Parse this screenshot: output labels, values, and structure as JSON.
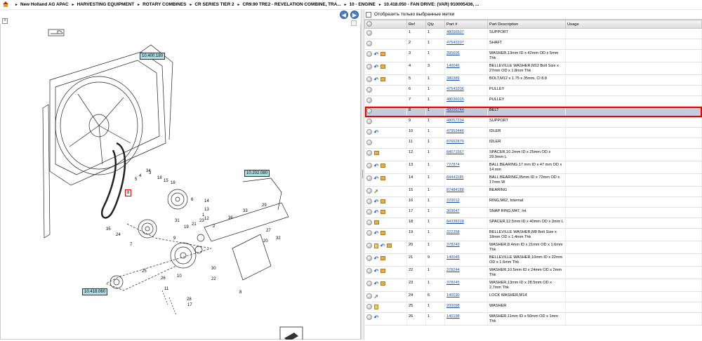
{
  "breadcrumb": [
    "New Holland AG APAC",
    "HARVESTING EQUIPMENT",
    "ROTARY COMBINES",
    "CR SERIES TIER 2",
    "CR9.90 TRE2 - REVELATION COMBINE, TRA...",
    "10 - ENGINE",
    "10.418.050 - FAN DRIVE: (VAR) 910005436, ..."
  ],
  "filter_label": "Отобразить только выбранные метки",
  "columns": [
    "",
    "Ref",
    "Qty",
    "Part #",
    "Part Description",
    "Usage"
  ],
  "colors": {
    "link": "#1a4fa8",
    "selected_row": "#c6ccd8",
    "highlight": "#ff0000",
    "callout": "#aedfe3"
  },
  "rows": [
    {
      "icons": [
        "circle"
      ],
      "ref": "1",
      "qty": "1",
      "part": "48056507",
      "desc": "SUPPORT",
      "usage": ""
    },
    {
      "icons": [
        "circle"
      ],
      "ref": "2",
      "qty": "1",
      "part": "47543207",
      "desc": "SHAFT",
      "usage": ""
    },
    {
      "icons": [
        "circle",
        "history",
        "box"
      ],
      "ref": "3",
      "qty": "1",
      "part": "395606",
      "desc": "WASHER,13mm ID x 42mm OD x 5mm Thk",
      "usage": ""
    },
    {
      "icons": [
        "circle",
        "history",
        "box"
      ],
      "ref": "4",
      "qty": "3",
      "part": "140046",
      "desc": "BELLEVILLE WASHER,M12 Bolt Size x 27mm OD x 1.8mm Thk",
      "usage": ""
    },
    {
      "icons": [
        "circle",
        "history",
        "box"
      ],
      "ref": "5",
      "qty": "1",
      "part": "380389",
      "desc": "BOLT,M12 x 1.75 x 35mm, Cl 8.8",
      "usage": ""
    },
    {
      "icons": [
        "circle"
      ],
      "ref": "6",
      "qty": "1",
      "part": "47543206",
      "desc": "PULLEY",
      "usage": ""
    },
    {
      "icons": [
        "circle"
      ],
      "ref": "7",
      "qty": "1",
      "part": "48036015",
      "desc": "PULLEY",
      "usage": ""
    },
    {
      "icons": [
        "circle"
      ],
      "ref": "8",
      "qty": "1",
      "part": "48056744",
      "desc": "BELT",
      "usage": "",
      "selected": true
    },
    {
      "icons": [
        "circle"
      ],
      "ref": "9",
      "qty": "1",
      "part": "48057234",
      "desc": "SUPPORT",
      "usage": ""
    },
    {
      "icons": [
        "circle",
        "history"
      ],
      "ref": "10",
      "qty": "1",
      "part": "47953446",
      "desc": "IDLER",
      "usage": ""
    },
    {
      "icons": [
        "circle"
      ],
      "ref": "11",
      "qty": "1",
      "part": "87662870",
      "desc": "IDLER",
      "usage": ""
    },
    {
      "icons": [
        "circle",
        "box"
      ],
      "ref": "12",
      "qty": "1",
      "part": "84071567",
      "desc": "SPACER,10.2mm ID x 25mm OD x 29.9mm L",
      "usage": ""
    },
    {
      "icons": [
        "circle",
        "history",
        "box"
      ],
      "ref": "13",
      "qty": "1",
      "part": "727874",
      "desc": "BALL BEARING,17 mm ID x 47 mm OD x 14 mm",
      "usage": ""
    },
    {
      "icons": [
        "circle",
        "history",
        "box"
      ],
      "ref": "14",
      "qty": "1",
      "part": "84441185",
      "desc": "BALL BEARING,35mm ID x 72mm OD x 17mm W",
      "usage": ""
    },
    {
      "icons": [
        "circle",
        "arrow"
      ],
      "ref": "15",
      "qty": "1",
      "part": "87484188",
      "desc": "BEARING",
      "usage": ""
    },
    {
      "icons": [
        "circle",
        "history",
        "box"
      ],
      "ref": "16",
      "qty": "1",
      "part": "370012",
      "desc": "RING,M62, Internal",
      "usage": ""
    },
    {
      "icons": [
        "circle",
        "history",
        "box"
      ],
      "ref": "17",
      "qty": "1",
      "part": "369647",
      "desc": "SNAP RING,M47, Int",
      "usage": ""
    },
    {
      "icons": [
        "circle",
        "box"
      ],
      "ref": "18",
      "qty": "1",
      "part": "84338318",
      "desc": "SPACER,12.5mm ID x 40mm OD x 3mm L",
      "usage": ""
    },
    {
      "icons": [
        "circle",
        "history",
        "box"
      ],
      "ref": "19",
      "qty": "1",
      "part": "322358",
      "desc": "BELLEVILLE WASHER,M8 Bolt Size x 18mm OD x 1.4mm Thk",
      "usage": ""
    },
    {
      "icons": [
        "circle",
        "folder",
        "history",
        "box"
      ],
      "ref": "20",
      "qty": "1",
      "part": "378243",
      "desc": "WASHER,8.4mm ID x 21mm OD x 1.6mm Thk",
      "usage": ""
    },
    {
      "icons": [
        "circle",
        "history",
        "box"
      ],
      "ref": "21",
      "qty": "9",
      "part": "140045",
      "desc": "BELLEVILLE WASHER,10mm ID x 22mm OD x 1.6mm Thk",
      "usage": ""
    },
    {
      "icons": [
        "circle",
        "history",
        "box"
      ],
      "ref": "22",
      "qty": "1",
      "part": "378244",
      "desc": "WASHER,10.5mm ID x 24mm OD x 2mm Thk",
      "usage": ""
    },
    {
      "icons": [
        "circle",
        "history",
        "box"
      ],
      "ref": "23",
      "qty": "1",
      "part": "378245",
      "desc": "WASHER,13mm ID x 28.5mm OD x 2.7mm Thk",
      "usage": ""
    },
    {
      "icons": [
        "circle",
        "arrow"
      ],
      "ref": "24",
      "qty": "6",
      "part": "140030",
      "desc": "LOCK WASHER,M14",
      "usage": ""
    },
    {
      "icons": [
        "circle",
        "folder"
      ],
      "ref": "25",
      "qty": "1",
      "part": "200098",
      "desc": "WASHER",
      "usage": ""
    },
    {
      "icons": [
        "circle",
        "history"
      ],
      "ref": "26",
      "qty": "1",
      "part": "140198",
      "desc": "WASHER,11mm ID x 50mm OD x 1mm Thk",
      "usage": ""
    }
  ],
  "callouts": [
    "10.400.180",
    "10.202.080",
    "10.418.060"
  ],
  "selected_callout": "8",
  "ref_labels": [
    "34",
    "18",
    "15",
    "16",
    "14",
    "13",
    "12",
    "9",
    "3",
    "4",
    "5",
    "35",
    "24",
    "7",
    "31",
    "21",
    "23",
    "19",
    "2",
    "6",
    "1",
    "36",
    "29",
    "33",
    "27",
    "20",
    "32",
    "30",
    "25",
    "28",
    "22",
    "26",
    "17",
    "11",
    "10",
    "8"
  ]
}
